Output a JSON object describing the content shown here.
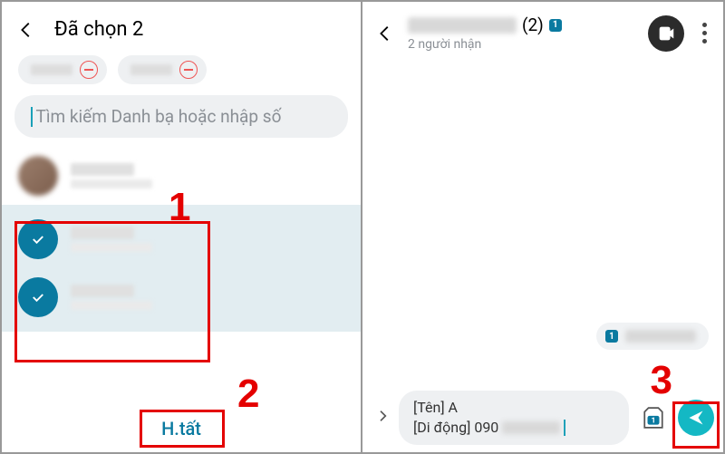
{
  "left": {
    "header_title": "Đã chọn 2",
    "search_placeholder": "Tìm kiếm Danh bạ hoặc nhập số",
    "done_label": "H.tất"
  },
  "right": {
    "thread_count": "(2)",
    "thread_badge": "1",
    "subtitle": "2 người nhận",
    "bubble_badge": "1",
    "compose_line1": "[Tên] A",
    "compose_line2_prefix": "[Di động] 090"
  },
  "annotations": {
    "n1": "1",
    "n2": "2",
    "n3": "3"
  }
}
